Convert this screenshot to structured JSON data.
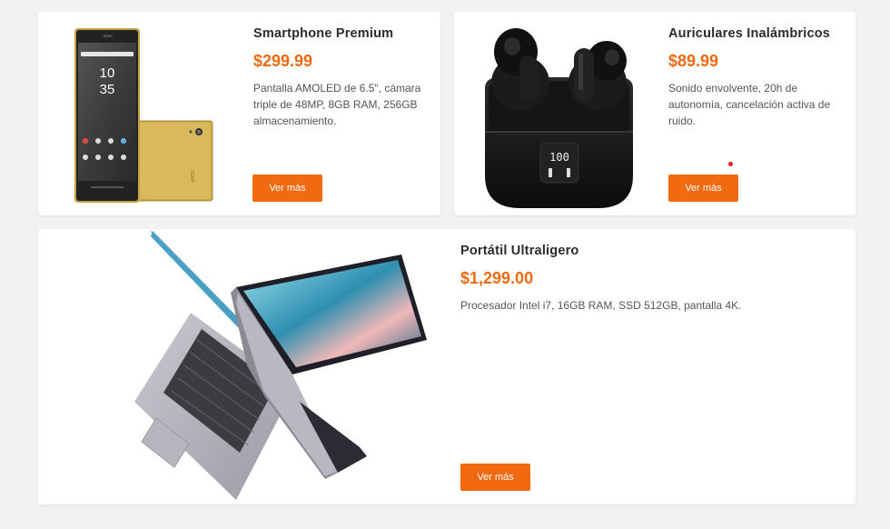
{
  "products": [
    {
      "title": "Smartphone Premium",
      "price": "$299.99",
      "description": "Pantalla AMOLED de 6.5\", cámara triple de 48MP, 8GB RAM, 256GB almacenamiento.",
      "button": "Ver más",
      "image_icon": "smartphone-image",
      "phone_time": [
        "10",
        "35"
      ],
      "phone_brand": "SONY"
    },
    {
      "title": "Auriculares Inalámbricos",
      "price": "$89.99",
      "description": "Sonido envolvente, 20h de autonomía, cancelación activa de ruido.",
      "button": "Ver más",
      "image_icon": "earbuds-image",
      "case_display": "100"
    },
    {
      "title": "Portátil Ultraligero",
      "price": "$1,299.00",
      "description": "Procesador Intel i7, 16GB RAM, SSD 512GB, pantalla 4K.",
      "button": "Ver más",
      "image_icon": "laptop-image"
    }
  ],
  "colors": {
    "accent": "#f26a0f",
    "price": "#f06a10",
    "background": "#f2f2f2",
    "card": "#ffffff",
    "indicator_dot": "#e0201a"
  }
}
